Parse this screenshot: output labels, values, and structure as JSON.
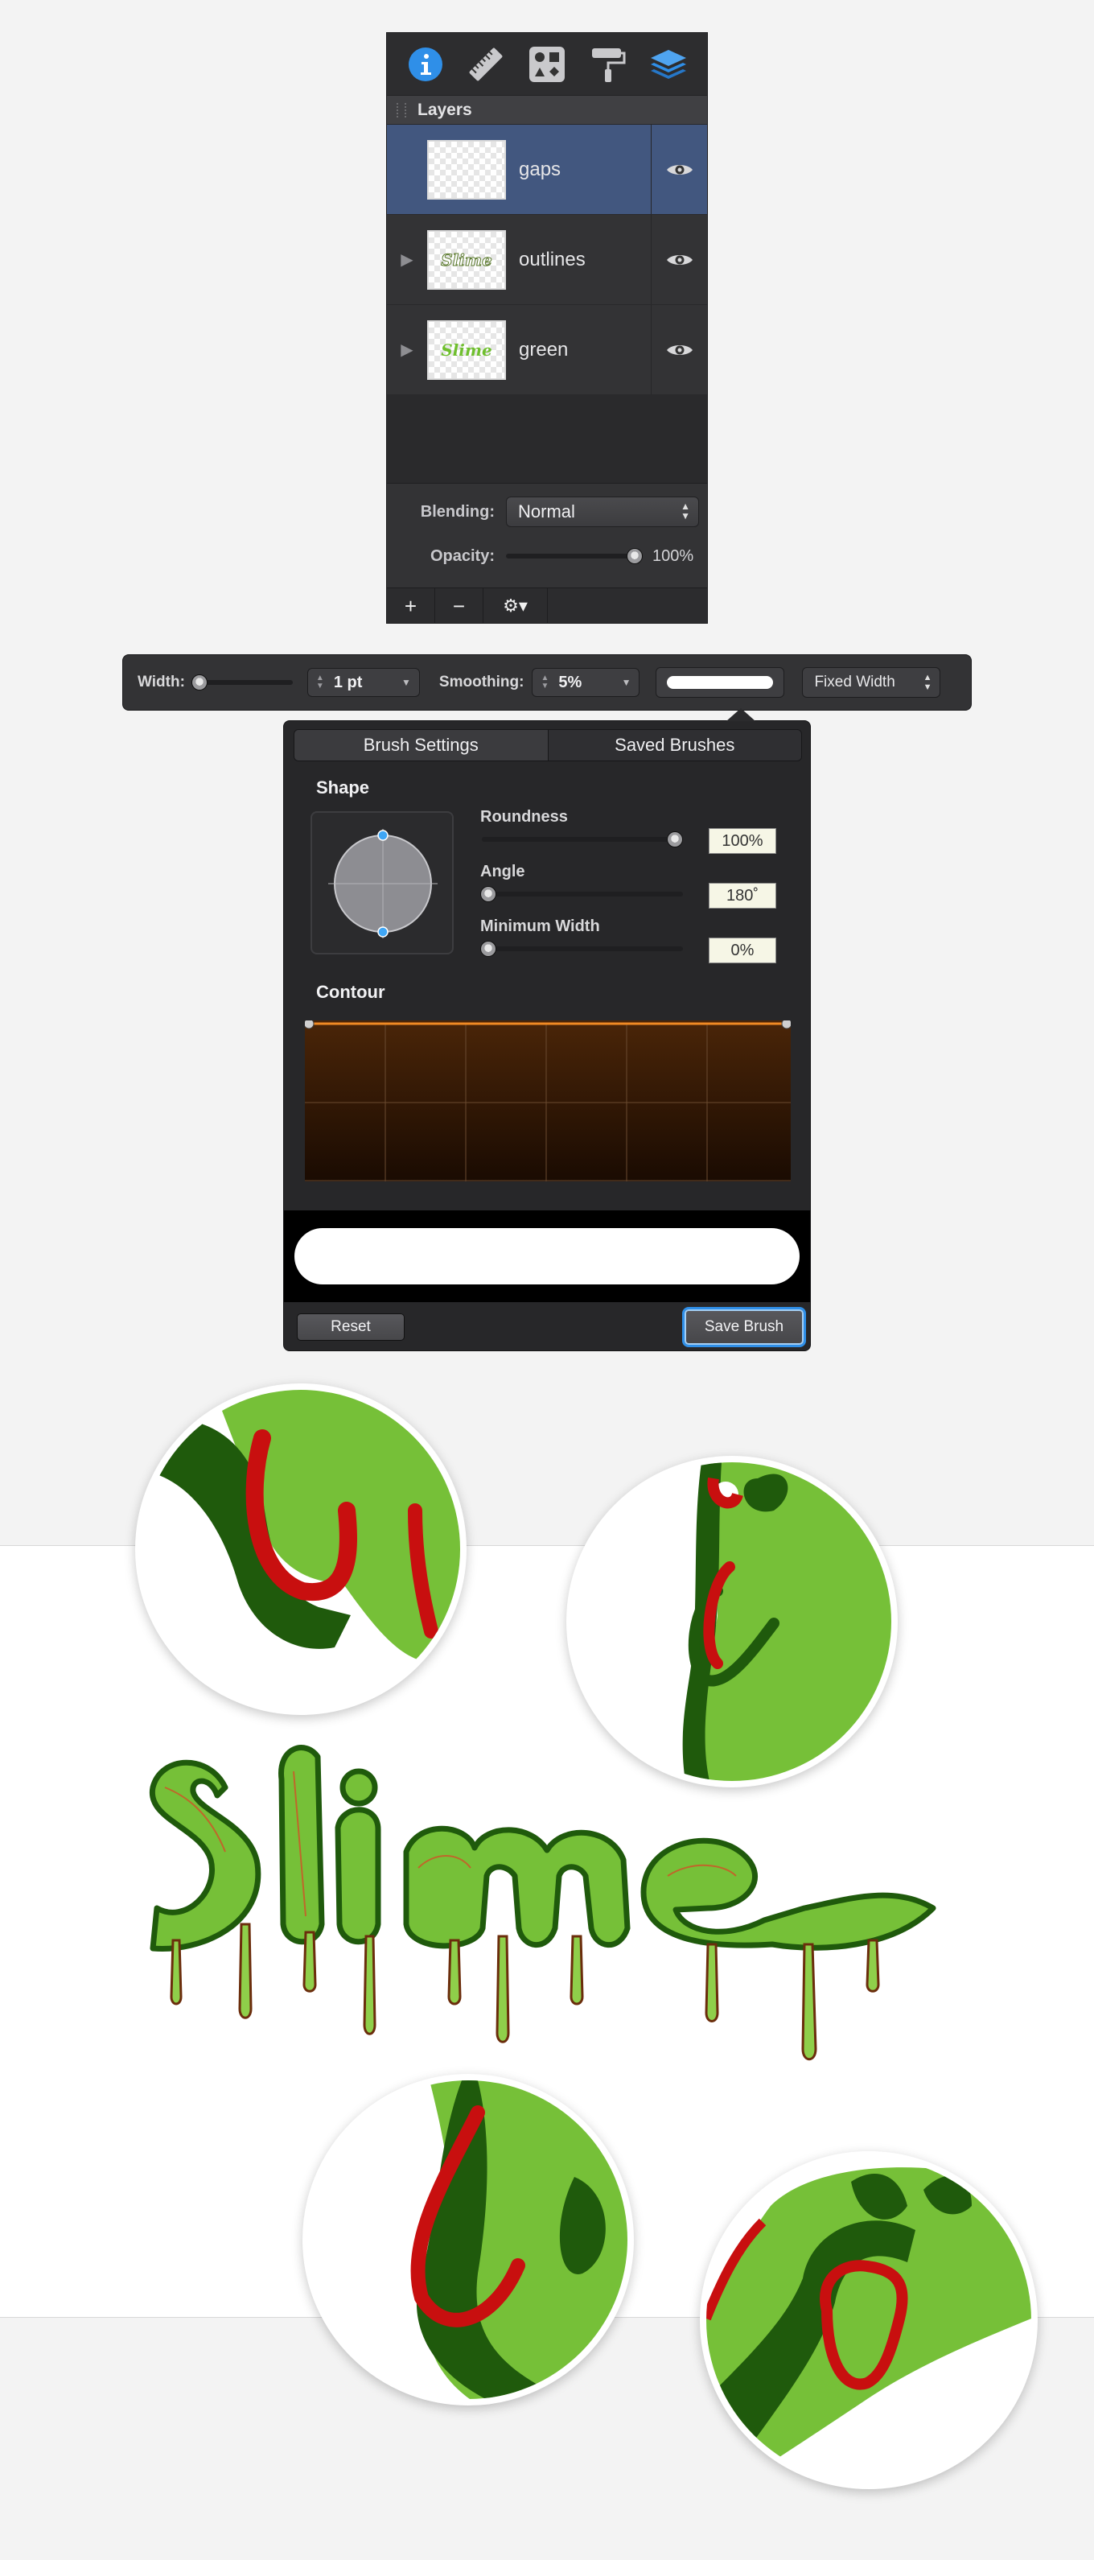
{
  "layers_panel": {
    "tabs": [
      {
        "icon": "info-icon"
      },
      {
        "icon": "ruler-icon"
      },
      {
        "icon": "shapes-icon"
      },
      {
        "icon": "paint-roller-icon"
      },
      {
        "icon": "layers-icon"
      }
    ],
    "header_title": "Layers",
    "layers": [
      {
        "name": "gaps",
        "selected": true,
        "expandable": false,
        "thumb_text": ""
      },
      {
        "name": "outlines",
        "selected": false,
        "expandable": true,
        "thumb_text": "Slime"
      },
      {
        "name": "green",
        "selected": false,
        "expandable": true,
        "thumb_text": "Slime"
      }
    ],
    "blending_label": "Blending:",
    "blending_value": "Normal",
    "opacity_label": "Opacity:",
    "opacity_value": "100%",
    "opacity_level": 1.0,
    "footer": {
      "add": "+",
      "remove": "−",
      "gear": "⚙▾"
    }
  },
  "brush_toolbar": {
    "width_label": "Width:",
    "width_value": "1 pt",
    "smoothing_label": "Smoothing:",
    "smoothing_value": "5%",
    "mode_value": "Fixed Width"
  },
  "brush_popover": {
    "tabs": [
      "Brush Settings",
      "Saved Brushes"
    ],
    "shape_title": "Shape",
    "roundness_label": "Roundness",
    "roundness_value": "100%",
    "roundness_level": 1.0,
    "angle_label": "Angle",
    "angle_value": "180˚",
    "min_width_label": "Minimum Width",
    "min_width_value": "0%",
    "contour_title": "Contour",
    "reset_label": "Reset",
    "save_label": "Save Brush"
  },
  "colors": {
    "panel": "#333335",
    "selection": "#42577f",
    "accent_blue": "#2f8fe8",
    "slime_green": "#76c038",
    "slime_dark": "#1f5a0c",
    "highlight_red": "#c80f0f"
  }
}
